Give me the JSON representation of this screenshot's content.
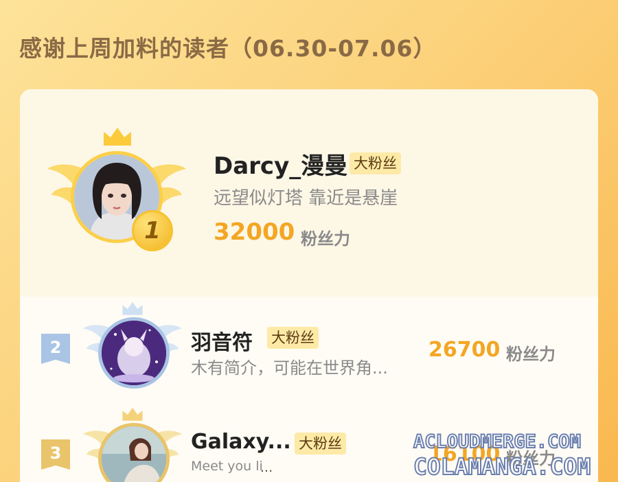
{
  "heading": "感谢上周加料的读者（06.30-07.06）",
  "fans": [
    {
      "rank": "1",
      "name": "Darcy_漫曼",
      "badge": "大粉丝",
      "signature": "远望似灯塔 靠近是悬崖",
      "score": "32000",
      "unit": "粉丝力"
    },
    {
      "rank": "2",
      "name": "羽音符",
      "badge": "大粉丝",
      "signature": "木有简介，可能在世界角...",
      "score": "26700",
      "unit": "粉丝力"
    },
    {
      "rank": "3",
      "name": "Galaxy...",
      "badge": "大粉丝",
      "signature": "Meet you li",
      "score": "16100",
      "unit": "粉丝力"
    }
  ],
  "watermark": {
    "line1": "ACLOUDMERGE.COM",
    "line2": "COLAMANGA.COM"
  },
  "colors": {
    "score": "#f3a624",
    "badge_bg": "#fdeaa6",
    "heading": "#8a6a45",
    "rank2": "#a9c4e4",
    "rank3": "#e9c46a"
  }
}
